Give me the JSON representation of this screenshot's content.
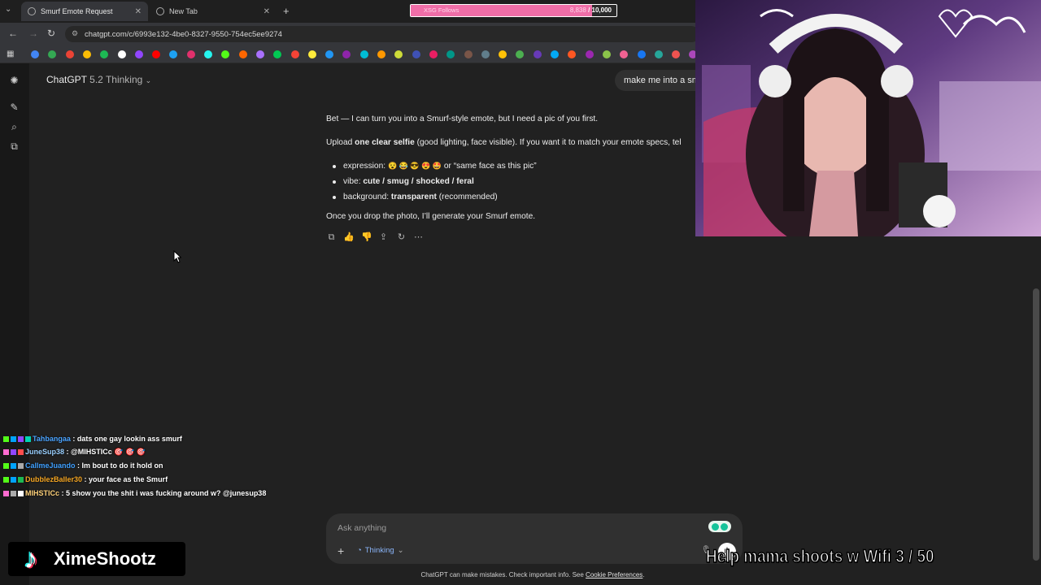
{
  "browser": {
    "tabs": [
      {
        "title": "Smurf Emote Request",
        "active": true
      },
      {
        "title": "New Tab",
        "active": false
      }
    ],
    "url": "chatgpt.com/c/6993e132-4be0-8327-9550-754ec5ee9274"
  },
  "follow_goal": {
    "label": "XSG Follows",
    "current": "8,838",
    "target": "/ 10,000",
    "progress": 0.88
  },
  "app": {
    "model_name": "ChatGPT",
    "model_version": "5.2 Thinking",
    "user_message": "make me into a sm",
    "reply": {
      "line1": "Bet — I can turn you into a Smurf-style emote, but I need a pic of you first.",
      "line2_pre": "Upload ",
      "line2_bold": "one clear selfie",
      "line2_post": " (good lighting, face visible). If you want it to match your emote specs, tel",
      "bullets": [
        {
          "pre": "expression: ",
          "emojis": "😵 😂 😎 😍 🤩",
          "post": " or “same face as this pic”"
        },
        {
          "pre": "vibe: ",
          "bold": "cute / smug / shocked / feral",
          "post": ""
        },
        {
          "pre": "background: ",
          "bold": "transparent",
          "post": " (recommended)"
        }
      ],
      "line_last": "Once you drop the photo, I’ll generate your Smurf emote."
    },
    "composer": {
      "placeholder": "Ask anything",
      "mode": "Thinking"
    },
    "disclaimer": "ChatGPT can make mistakes. Check important info. See ",
    "disclaimer_link": "Cookie Preferences",
    "disclaimer_end": "."
  },
  "chat_messages": [
    {
      "user": "Tahbangaa",
      "color": "#4aa3ff",
      "text": ": dats one gay lookin ass smurf"
    },
    {
      "user": "JuneSup38",
      "color": "#9ad0ff",
      "text": ": @MIHSTICc 🎯 🎯 🎯"
    },
    {
      "user": "CallmeJuando",
      "color": "#3fa0ff",
      "text": ": Im bout to do it hold on"
    },
    {
      "user": "DubblezBaller30",
      "color": "#f5a623",
      "text": ": your face as the Smurf"
    },
    {
      "user": "MIHSTICc",
      "color": "#ffd27a",
      "text": ": 5 show you the shit i was fucking around w? @junesup38"
    }
  ],
  "overlay": {
    "tiktok_handle": "XimeShootz",
    "goal_text": "Help mama shoots w Wifi  3 / 50"
  },
  "colors": {
    "accent_pink": "#f06ea8",
    "chatgpt_bg": "#212121",
    "think_blue": "#8ab4f8"
  }
}
